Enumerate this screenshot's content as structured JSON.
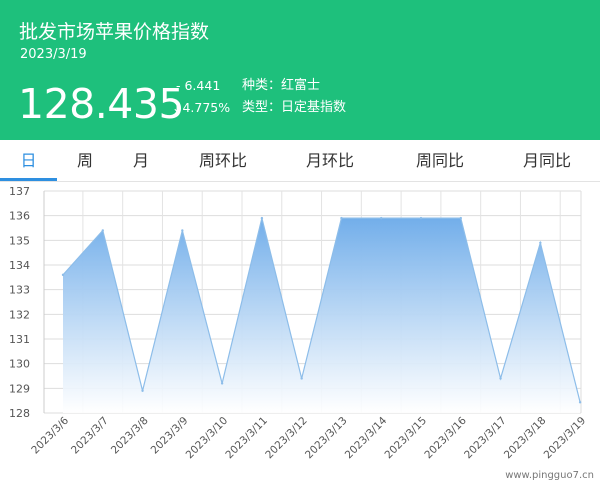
{
  "header": {
    "title": "批发市场苹果价格指数",
    "date": "2023/3/19",
    "price": "128.435",
    "change": "- 6.441",
    "change_pct": "↓4.775%",
    "variety": "种类：红富士",
    "index_type": "类型：日定基指数",
    "background_color": "#1ec07c"
  },
  "tabs": [
    {
      "label": "日",
      "active": true
    },
    {
      "label": "周",
      "active": false
    },
    {
      "label": "月",
      "active": false
    },
    {
      "label": "周环比",
      "active": false
    },
    {
      "label": "月环比",
      "active": false
    },
    {
      "label": "周同比",
      "active": false
    },
    {
      "label": "月同比",
      "active": false
    }
  ],
  "accent_color": "#2e8fe0",
  "watermark": "www.pingguo7.cn",
  "chart_data": {
    "type": "area",
    "x": [
      "2023/3/6",
      "2023/3/7",
      "2023/3/8",
      "2023/3/9",
      "2023/3/10",
      "2023/3/11",
      "2023/3/12",
      "2023/3/13",
      "2023/3/14",
      "2023/3/15",
      "2023/3/16",
      "2023/3/17",
      "2023/3/18",
      "2023/3/19"
    ],
    "values": [
      133.6,
      135.4,
      128.9,
      135.4,
      129.2,
      135.9,
      129.4,
      135.9,
      135.9,
      135.9,
      135.9,
      129.4,
      134.9,
      128.435
    ],
    "ylim": [
      128,
      137
    ],
    "yticks": [
      128,
      129,
      130,
      131,
      132,
      133,
      134,
      135,
      136,
      137
    ],
    "grid": true,
    "line_color": "#8dbde9",
    "fill_top_color": "#72aeea",
    "fill_bottom_color": "#ffffff"
  }
}
